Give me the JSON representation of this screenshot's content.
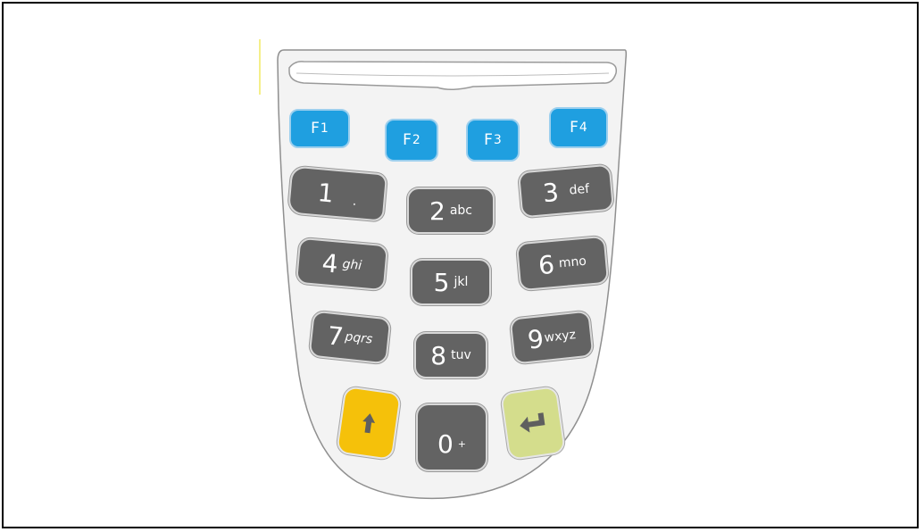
{
  "keypad": {
    "function_keys": [
      {
        "letter": "F",
        "digit": "1"
      },
      {
        "letter": "F",
        "digit": "2"
      },
      {
        "letter": "F",
        "digit": "3"
      },
      {
        "letter": "F",
        "digit": "4"
      }
    ],
    "number_keys": [
      {
        "num": "1",
        "sub": "."
      },
      {
        "num": "2",
        "sub": "abc"
      },
      {
        "num": "3",
        "sub": "def"
      },
      {
        "num": "4",
        "sub": "ghi"
      },
      {
        "num": "5",
        "sub": "jkl"
      },
      {
        "num": "6",
        "sub": "mno"
      },
      {
        "num": "7",
        "sub": "pqrs"
      },
      {
        "num": "8",
        "sub": "tuv"
      },
      {
        "num": "9",
        "sub": "wxyz"
      },
      {
        "num": "0",
        "sub": "+"
      }
    ],
    "colors": {
      "function_key": "#1f9fe0",
      "number_key": "#636363",
      "shift_key": "#f5c10a",
      "enter_key": "#d4dd8c",
      "bezel": "#f2f2f2"
    },
    "icons": {
      "shift": "arrow-up-icon",
      "enter": "enter-return-icon"
    }
  }
}
